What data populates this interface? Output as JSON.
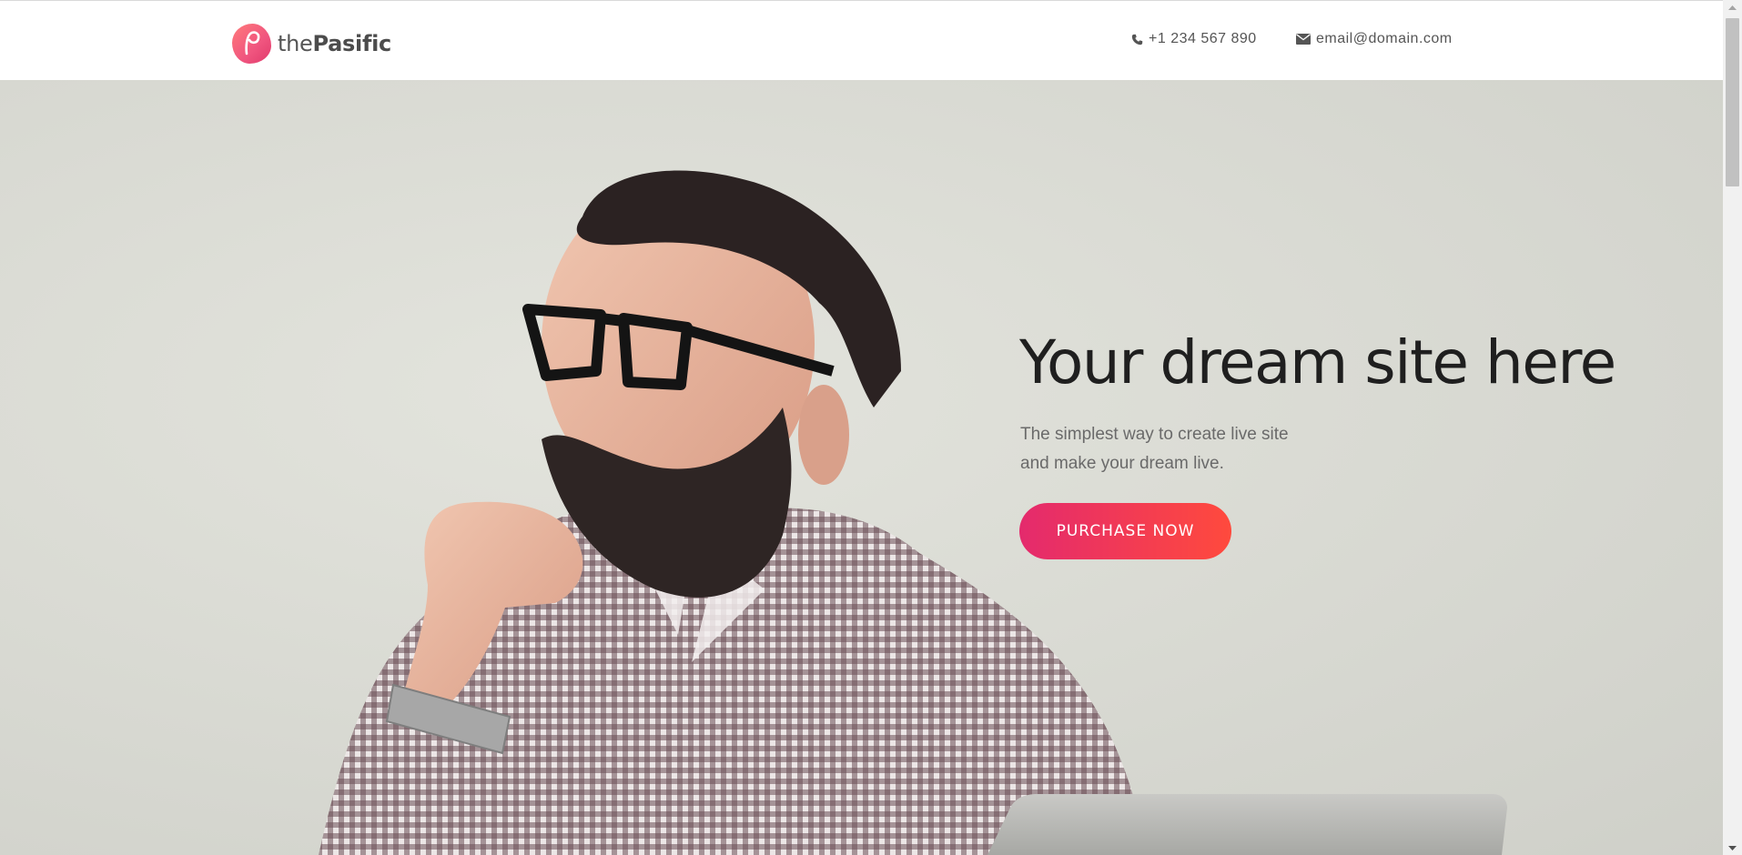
{
  "header": {
    "logo": {
      "prefix": "the",
      "brand": "Pasific"
    },
    "phone": "+1 234 567 890",
    "email": "email@domain.com",
    "phone_icon": "phone-icon",
    "email_icon": "envelope-icon"
  },
  "hero": {
    "title": "Your dream site here",
    "subtitle_line1": "The simplest way to create live site",
    "subtitle_line2": "and make your dream live.",
    "cta_label": "PURCHASE NOW"
  },
  "colors": {
    "brand_gradient_start": "#e42a6d",
    "brand_gradient_end": "#ff4a3d",
    "text_dark": "#1f1f1f",
    "text_muted": "#6a6a6a"
  }
}
